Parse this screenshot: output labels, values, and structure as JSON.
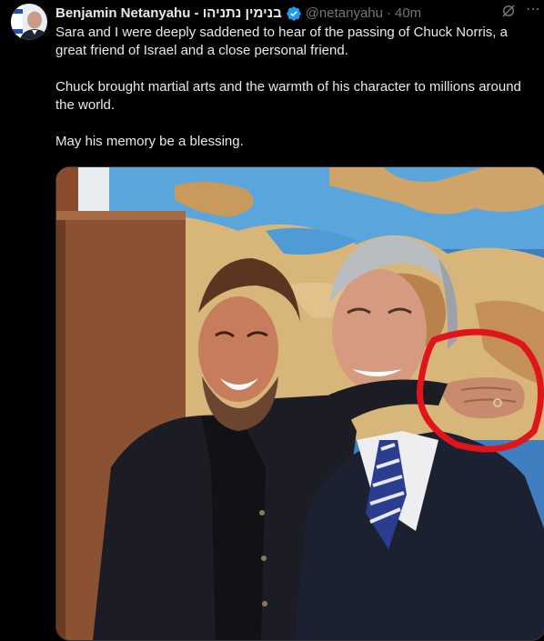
{
  "author": {
    "display_name": "Benjamin Netanyahu - בנימין נתניהו",
    "handle": "@netanyahu",
    "separator": "·",
    "timestamp": "40m",
    "verified": true,
    "verified_color": "#1d9bf0"
  },
  "icons": {
    "avatar": "avatar-photo",
    "verified": "verified-badge-icon",
    "grok": "grok-icon",
    "more": "more-options-icon"
  },
  "tweet": {
    "paragraphs": [
      "Sara and I were deeply saddened to hear of the passing of Chuck Norris, a great friend of Israel and a close personal friend.",
      "Chuck brought martial arts and the warmth of his character to millions around the world.",
      "May his memory be a blessing."
    ]
  },
  "media": {
    "alt": "Photo of two men laughing in front of a wall map, with a red circle drawn around a hand on a shoulder",
    "annotation_color": "#e0151b"
  }
}
